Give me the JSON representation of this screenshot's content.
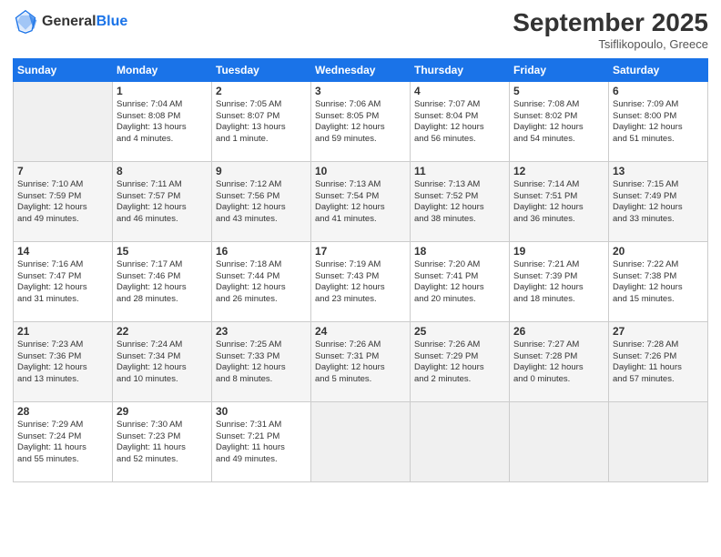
{
  "header": {
    "logo_general": "General",
    "logo_blue": "Blue",
    "month_title": "September 2025",
    "location": "Tsiflikopoulo, Greece"
  },
  "days_of_week": [
    "Sunday",
    "Monday",
    "Tuesday",
    "Wednesday",
    "Thursday",
    "Friday",
    "Saturday"
  ],
  "weeks": [
    [
      {
        "day": "",
        "info": ""
      },
      {
        "day": "1",
        "info": "Sunrise: 7:04 AM\nSunset: 8:08 PM\nDaylight: 13 hours\nand 4 minutes."
      },
      {
        "day": "2",
        "info": "Sunrise: 7:05 AM\nSunset: 8:07 PM\nDaylight: 13 hours\nand 1 minute."
      },
      {
        "day": "3",
        "info": "Sunrise: 7:06 AM\nSunset: 8:05 PM\nDaylight: 12 hours\nand 59 minutes."
      },
      {
        "day": "4",
        "info": "Sunrise: 7:07 AM\nSunset: 8:04 PM\nDaylight: 12 hours\nand 56 minutes."
      },
      {
        "day": "5",
        "info": "Sunrise: 7:08 AM\nSunset: 8:02 PM\nDaylight: 12 hours\nand 54 minutes."
      },
      {
        "day": "6",
        "info": "Sunrise: 7:09 AM\nSunset: 8:00 PM\nDaylight: 12 hours\nand 51 minutes."
      }
    ],
    [
      {
        "day": "7",
        "info": "Sunrise: 7:10 AM\nSunset: 7:59 PM\nDaylight: 12 hours\nand 49 minutes."
      },
      {
        "day": "8",
        "info": "Sunrise: 7:11 AM\nSunset: 7:57 PM\nDaylight: 12 hours\nand 46 minutes."
      },
      {
        "day": "9",
        "info": "Sunrise: 7:12 AM\nSunset: 7:56 PM\nDaylight: 12 hours\nand 43 minutes."
      },
      {
        "day": "10",
        "info": "Sunrise: 7:13 AM\nSunset: 7:54 PM\nDaylight: 12 hours\nand 41 minutes."
      },
      {
        "day": "11",
        "info": "Sunrise: 7:13 AM\nSunset: 7:52 PM\nDaylight: 12 hours\nand 38 minutes."
      },
      {
        "day": "12",
        "info": "Sunrise: 7:14 AM\nSunset: 7:51 PM\nDaylight: 12 hours\nand 36 minutes."
      },
      {
        "day": "13",
        "info": "Sunrise: 7:15 AM\nSunset: 7:49 PM\nDaylight: 12 hours\nand 33 minutes."
      }
    ],
    [
      {
        "day": "14",
        "info": "Sunrise: 7:16 AM\nSunset: 7:47 PM\nDaylight: 12 hours\nand 31 minutes."
      },
      {
        "day": "15",
        "info": "Sunrise: 7:17 AM\nSunset: 7:46 PM\nDaylight: 12 hours\nand 28 minutes."
      },
      {
        "day": "16",
        "info": "Sunrise: 7:18 AM\nSunset: 7:44 PM\nDaylight: 12 hours\nand 26 minutes."
      },
      {
        "day": "17",
        "info": "Sunrise: 7:19 AM\nSunset: 7:43 PM\nDaylight: 12 hours\nand 23 minutes."
      },
      {
        "day": "18",
        "info": "Sunrise: 7:20 AM\nSunset: 7:41 PM\nDaylight: 12 hours\nand 20 minutes."
      },
      {
        "day": "19",
        "info": "Sunrise: 7:21 AM\nSunset: 7:39 PM\nDaylight: 12 hours\nand 18 minutes."
      },
      {
        "day": "20",
        "info": "Sunrise: 7:22 AM\nSunset: 7:38 PM\nDaylight: 12 hours\nand 15 minutes."
      }
    ],
    [
      {
        "day": "21",
        "info": "Sunrise: 7:23 AM\nSunset: 7:36 PM\nDaylight: 12 hours\nand 13 minutes."
      },
      {
        "day": "22",
        "info": "Sunrise: 7:24 AM\nSunset: 7:34 PM\nDaylight: 12 hours\nand 10 minutes."
      },
      {
        "day": "23",
        "info": "Sunrise: 7:25 AM\nSunset: 7:33 PM\nDaylight: 12 hours\nand 8 minutes."
      },
      {
        "day": "24",
        "info": "Sunrise: 7:26 AM\nSunset: 7:31 PM\nDaylight: 12 hours\nand 5 minutes."
      },
      {
        "day": "25",
        "info": "Sunrise: 7:26 AM\nSunset: 7:29 PM\nDaylight: 12 hours\nand 2 minutes."
      },
      {
        "day": "26",
        "info": "Sunrise: 7:27 AM\nSunset: 7:28 PM\nDaylight: 12 hours\nand 0 minutes."
      },
      {
        "day": "27",
        "info": "Sunrise: 7:28 AM\nSunset: 7:26 PM\nDaylight: 11 hours\nand 57 minutes."
      }
    ],
    [
      {
        "day": "28",
        "info": "Sunrise: 7:29 AM\nSunset: 7:24 PM\nDaylight: 11 hours\nand 55 minutes."
      },
      {
        "day": "29",
        "info": "Sunrise: 7:30 AM\nSunset: 7:23 PM\nDaylight: 11 hours\nand 52 minutes."
      },
      {
        "day": "30",
        "info": "Sunrise: 7:31 AM\nSunset: 7:21 PM\nDaylight: 11 hours\nand 49 minutes."
      },
      {
        "day": "",
        "info": ""
      },
      {
        "day": "",
        "info": ""
      },
      {
        "day": "",
        "info": ""
      },
      {
        "day": "",
        "info": ""
      }
    ]
  ]
}
